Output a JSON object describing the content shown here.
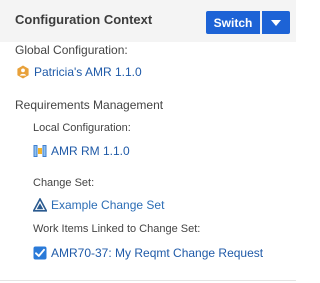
{
  "header": {
    "title": "Configuration Context",
    "switch_label": "Switch"
  },
  "global": {
    "label": "Global Configuration:",
    "link": "Patricia's AMR 1.1.0",
    "icon": "global-config-icon"
  },
  "requirements": {
    "label": "Requirements Management",
    "local_label": "Local Configuration:",
    "local_link": "AMR RM 1.1.0",
    "local_icon": "stream-config-icon",
    "changeset_label": "Change Set:",
    "changeset_link": "Example Change Set",
    "changeset_icon": "change-set-icon",
    "workitems_label": "Work Items Linked to Change Set:",
    "workitem_link": "AMR70-37: My Reqmt Change Request",
    "workitem_icon": "checkbox-checked-icon"
  },
  "colors": {
    "accent": "#1d63d6",
    "link": "#1f5aa8",
    "global_icon": "#e8a13a"
  }
}
